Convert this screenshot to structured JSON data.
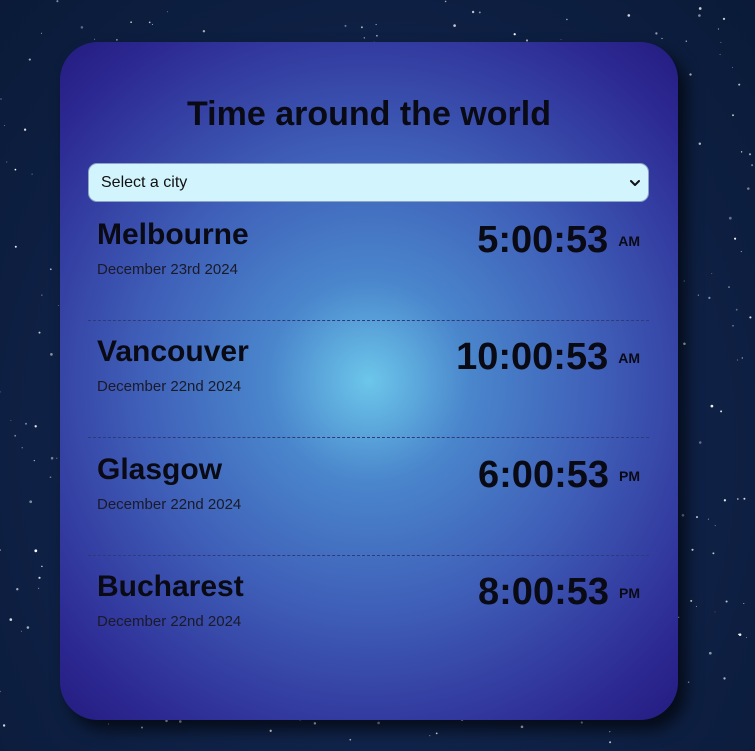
{
  "page": {
    "title": "Time around the world"
  },
  "city_select": {
    "placeholder": "Select a city"
  },
  "cities": [
    {
      "name": "Melbourne",
      "date": "December 23rd 2024",
      "time": "5:00:53",
      "ampm": "AM"
    },
    {
      "name": "Vancouver",
      "date": "December 22nd 2024",
      "time": "10:00:53",
      "ampm": "AM"
    },
    {
      "name": "Glasgow",
      "date": "December 22nd 2024",
      "time": "6:00:53",
      "ampm": "PM"
    },
    {
      "name": "Bucharest",
      "date": "December 22nd 2024",
      "time": "8:00:53",
      "ampm": "PM"
    }
  ],
  "icons": {
    "select_chevron": "chevron-down-icon"
  },
  "colors": {
    "text": "#0a0a14",
    "select_background": "#d2f4fc",
    "card_center": "#6cc6ea",
    "card_edge": "#241c80"
  }
}
